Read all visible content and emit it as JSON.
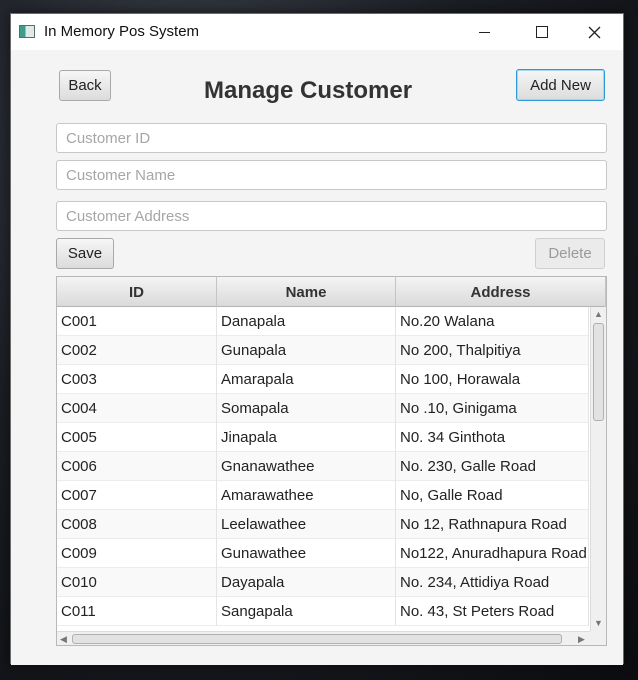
{
  "window": {
    "title": "In Memory Pos System",
    "icon": "app-window-icon"
  },
  "header": {
    "back_label": "Back",
    "title": "Manage Customer",
    "add_new_label": "Add New"
  },
  "form": {
    "customer_id": {
      "value": "",
      "placeholder": "Customer ID"
    },
    "customer_name": {
      "value": "",
      "placeholder": "Customer Name"
    },
    "customer_address": {
      "value": "",
      "placeholder": "Customer Address"
    },
    "save_label": "Save",
    "delete_label": "Delete"
  },
  "table": {
    "columns": [
      "ID",
      "Name",
      "Address"
    ],
    "rows": [
      [
        "C001",
        "Danapala",
        "No.20 Walana"
      ],
      [
        "C002",
        "Gunapala",
        "No 200, Thalpitiya"
      ],
      [
        "C003",
        "Amarapala",
        "No 100, Horawala"
      ],
      [
        "C004",
        "Somapala",
        "No .10, Ginigama"
      ],
      [
        "C005",
        "Jinapala",
        "N0. 34 Ginthota"
      ],
      [
        "C006",
        "Gnanawathee",
        "No. 230, Galle Road"
      ],
      [
        "C007",
        "Amarawathee",
        "No, Galle Road"
      ],
      [
        "C008",
        "Leelawathee",
        "No 12, Rathnapura Road"
      ],
      [
        "C009",
        "Gunawathee",
        "No122, Anuradhapura Road"
      ],
      [
        "C010",
        "Dayapala",
        "No. 234, Attidiya Road"
      ],
      [
        "C011",
        "Sangapala",
        "No. 43, St Peters Road"
      ]
    ]
  },
  "colors": {
    "accent": "#2d9ad8",
    "disabled_text": "#9a9a9a"
  }
}
